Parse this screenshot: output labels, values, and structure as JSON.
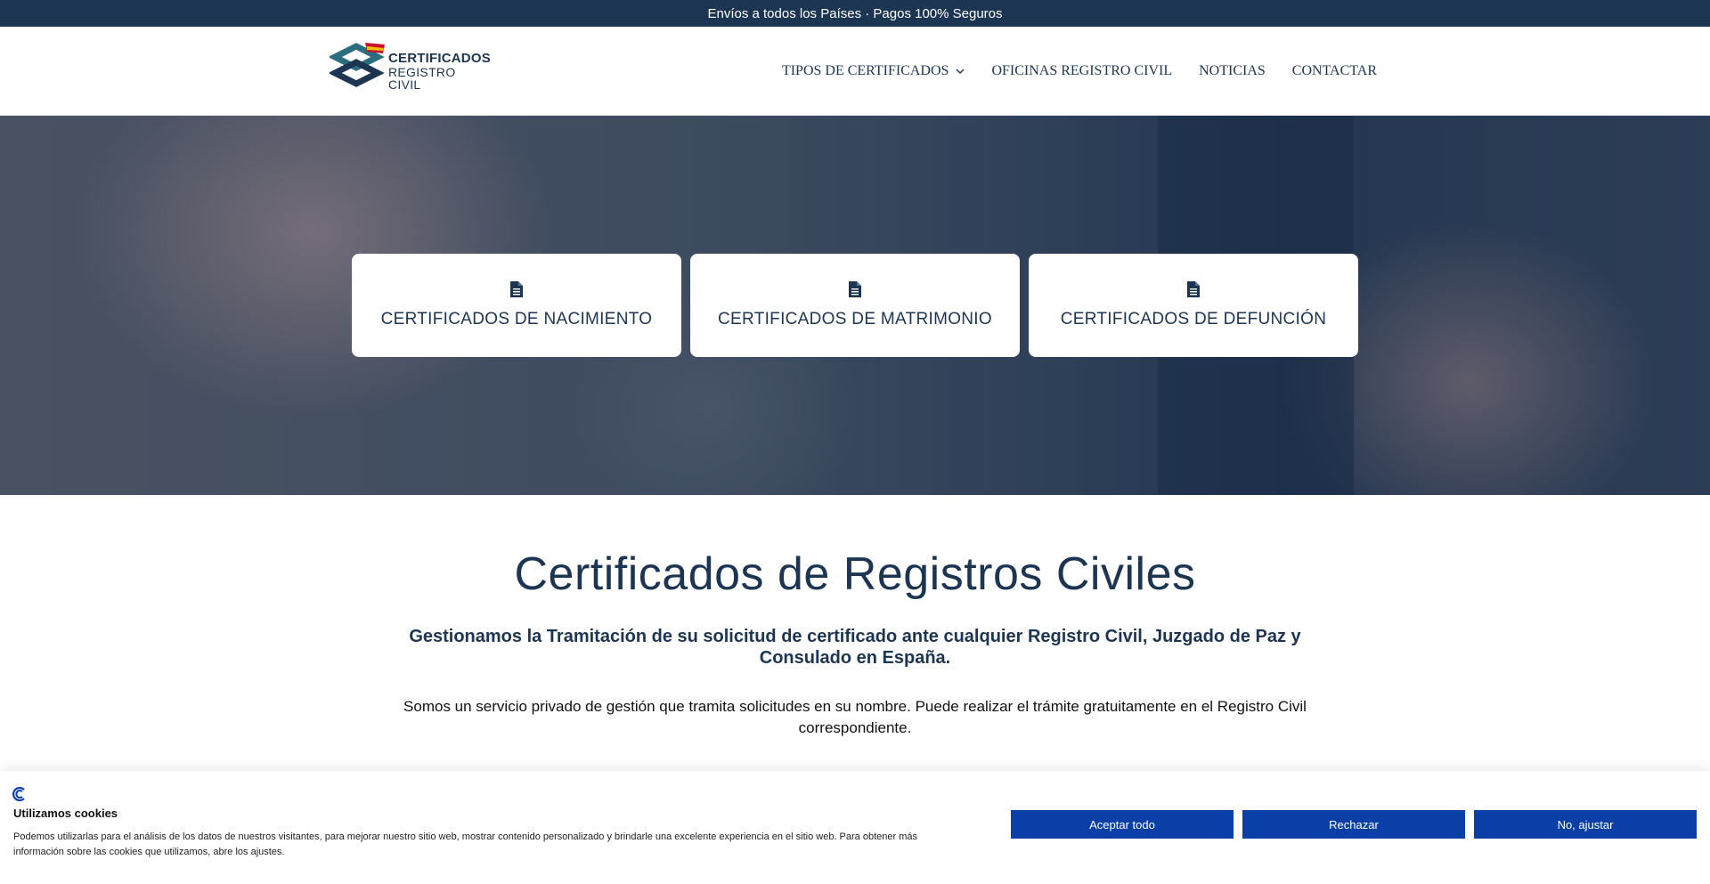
{
  "topbar": {
    "text": "Envíos a todos los Países · Pagos 100% Seguros"
  },
  "header": {
    "logo": {
      "line1": "CERTIFICADOS",
      "line2": "REGISTRO CIVIL",
      "icon": "logo-emblem-icon"
    },
    "nav": [
      {
        "label": "TIPOS DE CERTIFICADOS",
        "has_dropdown": true
      },
      {
        "label": "OFICINAS REGISTRO CIVIL"
      },
      {
        "label": "NOTICIAS"
      },
      {
        "label": "CONTACTAR"
      }
    ]
  },
  "hero": {
    "cards": [
      {
        "label": "CERTIFICADOS DE NACIMIENTO",
        "icon": "document-icon"
      },
      {
        "label": "CERTIFICADOS DE MATRIMONIO",
        "icon": "document-icon"
      },
      {
        "label": "CERTIFICADOS DE DEFUNCIÓN",
        "icon": "document-icon"
      }
    ]
  },
  "main": {
    "title": "Certificados de Registros Civiles",
    "subtitle": "Gestionamos la Tramitación de su solicitud de certificado ante cualquier Registro Civil, Juzgado de Paz y Consulado en España.",
    "body": "Somos un servicio privado de gestión que tramita solicitudes en su nombre. Puede realizar el trámite gratuitamente en el Registro Civil correspondiente."
  },
  "cookie_banner": {
    "title": "Utilizamos cookies",
    "text": "Podemos utilizarlas para el análisis de los datos de nuestros visitantes, para mejorar nuestro sitio web, mostrar contenido personalizado y brindarle una excelente experiencia en el sitio web. Para obtener más información sobre las cookies que utilizamos, abre los ajustes.",
    "accept_label": "Aceptar todo",
    "reject_label": "Rechazar",
    "adjust_label": "No, ajustar"
  },
  "colors": {
    "brand_navy": "#1c3553",
    "cookie_button": "#0a3fa8",
    "logo_teal": "#2b6c7e"
  }
}
